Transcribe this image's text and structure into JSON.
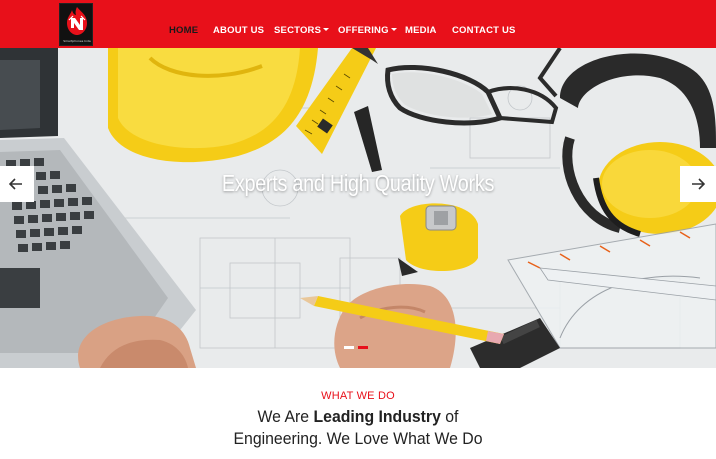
{
  "brand": {
    "logo_name": "flame-logo",
    "tagline": "Smartphones Inda",
    "accent_color": "#e8101a"
  },
  "nav": {
    "items": [
      {
        "label": "HOME",
        "active": true,
        "dropdown": false
      },
      {
        "label": "ABOUT US",
        "active": false,
        "dropdown": false
      },
      {
        "label": "SECTORS",
        "active": false,
        "dropdown": true
      },
      {
        "label": "OFFERING",
        "active": false,
        "dropdown": true
      },
      {
        "label": "MEDIA",
        "active": false,
        "dropdown": false
      },
      {
        "label": "CONTACT US",
        "active": false,
        "dropdown": false
      }
    ]
  },
  "hero": {
    "title": "Experts and High Quality Works",
    "prev_icon": "arrow-left-icon",
    "next_icon": "arrow-right-icon",
    "slides_total": 2,
    "active_slide": 2
  },
  "intro": {
    "eyebrow": "WHAT WE DO",
    "heading_pre": "We Are ",
    "heading_bold": "Leading Industry",
    "heading_post": " of",
    "heading_line2": "Engineering. We Love What We Do"
  }
}
